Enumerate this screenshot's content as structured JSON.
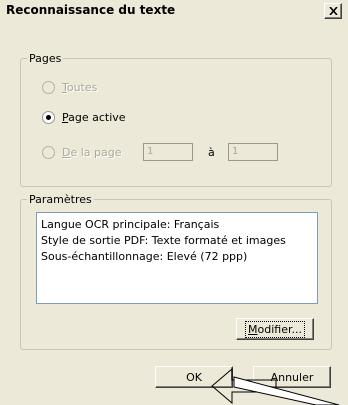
{
  "window": {
    "title": "Reconnaissance du texte",
    "close_label": "×"
  },
  "pages_group": {
    "legend": "Pages",
    "options": [
      {
        "label": "Toutes",
        "underline_char": "T",
        "rest": "outes",
        "selected": false,
        "enabled": false
      },
      {
        "label": "Page active",
        "underline_char": "P",
        "rest": "age active",
        "selected": true,
        "enabled": true
      },
      {
        "label": "De la page",
        "underline_char": "D",
        "rest": "e la page",
        "selected": false,
        "enabled": false
      }
    ],
    "from_value": "1",
    "to_label": "à",
    "to_value": "1"
  },
  "params_group": {
    "legend": "Paramètres",
    "lines": [
      "Langue OCR principale: Français",
      "Style de sortie PDF: Texte formaté et images",
      "Sous-échantillonnage: Elevé (72 ppp)"
    ],
    "modify_underline": "M",
    "modify_rest": "odifier..."
  },
  "buttons": {
    "ok": "OK",
    "cancel": "Annuler"
  }
}
